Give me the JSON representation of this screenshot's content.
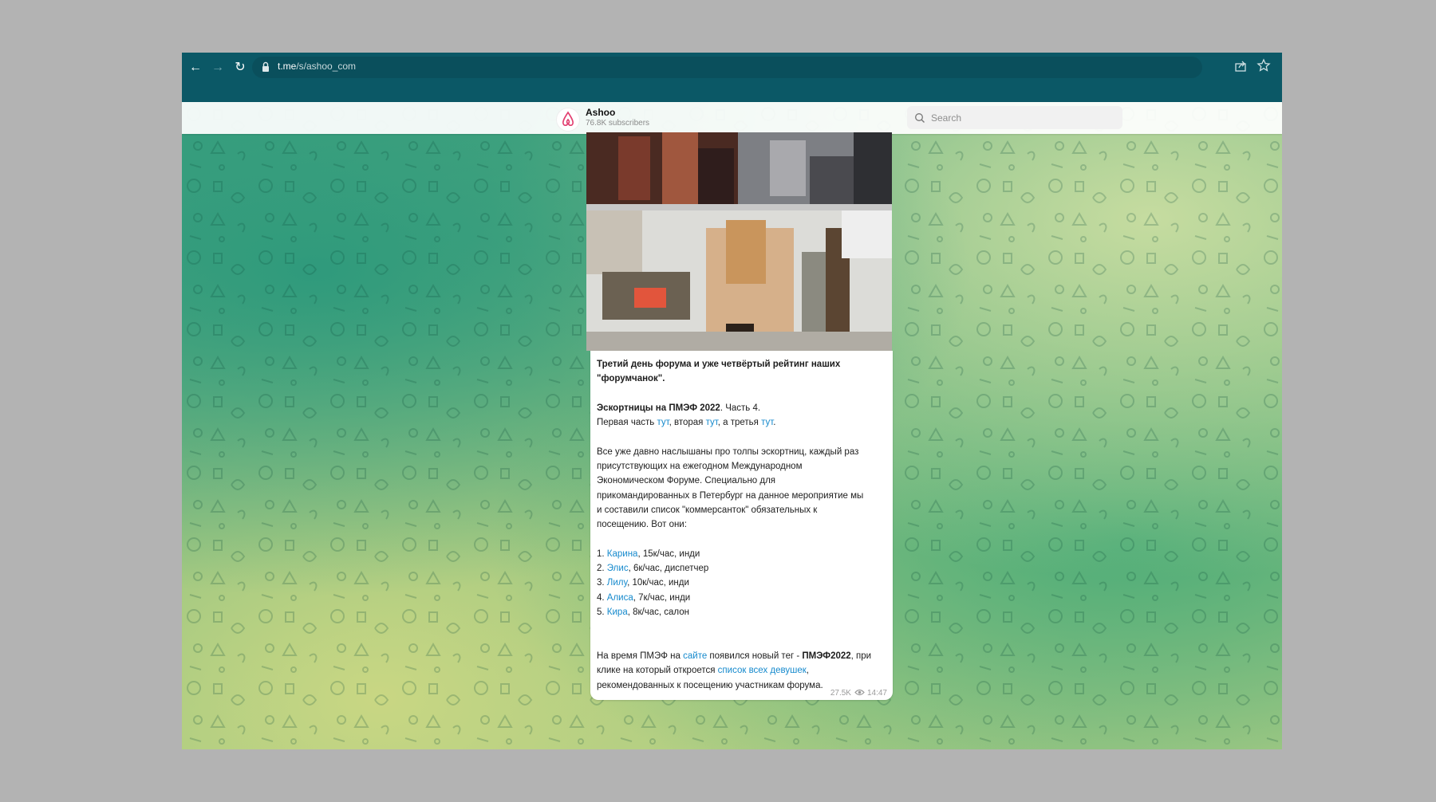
{
  "browser": {
    "url_domain": "t.me",
    "url_path": "/s/ashoo_com",
    "icons": [
      "back-icon",
      "forward-icon",
      "reload-icon",
      "lock-icon",
      "share-icon",
      "star-icon"
    ]
  },
  "header": {
    "channel_name": "Ashoo",
    "subscribers": "76.8K subscribers",
    "search_placeholder": "Search",
    "avatar_color": "#e23d6f"
  },
  "message": {
    "title_line1": "Третий день форума и уже четвёртый рейтинг наших",
    "title_line2": "\"форумчанок\".",
    "part_heading_bold": "Эскортницы на ПМЭФ 2022",
    "part_heading_rest": ". Часть 4.",
    "links_intro": "Первая часть ",
    "link_1": "тут",
    "links_mid1": ", вторая ",
    "link_2": "тут",
    "links_mid2": ", а третья ",
    "link_3": "тут",
    "links_end": ".",
    "para_lines": [
      "Все уже давно наслышаны про толпы эскортниц, каждый раз",
      "присутствующих на ежегодном Международном",
      "Экономическом Форуме. Специально для",
      "прикомандированных в Петербург на данное мероприятие мы",
      "и составили список \"коммерсанток\" обязательных к",
      "посещению. Вот они:"
    ],
    "list": [
      {
        "num": "1. ",
        "name": "Карина",
        "details": ", 15к/час, инди"
      },
      {
        "num": "2. ",
        "name": "Элис",
        "details": ", 6к/час, диспетчер"
      },
      {
        "num": "3. ",
        "name": "Лилу",
        "details": ", 10к/час, инди"
      },
      {
        "num": "4. ",
        "name": "Алиса",
        "details": ", 7к/час, инди"
      },
      {
        "num": "5. ",
        "name": "Кира",
        "details": ", 8к/час, салон"
      }
    ],
    "footer_intro": "На время ПМЭФ на ",
    "footer_link_site": "сайте",
    "footer_mid": " появился новый тег - ",
    "footer_tag": "ПМЭФ2022",
    "footer_after_tag": ", при",
    "footer_line2_start": "клике на который откроется ",
    "footer_link_list": "список всех девушек",
    "footer_line2_end": ",",
    "footer_line3": "рекомендованных к посещению участникам форума.",
    "views": "27.5K",
    "time": "14:47",
    "link_color": "#168acd"
  }
}
